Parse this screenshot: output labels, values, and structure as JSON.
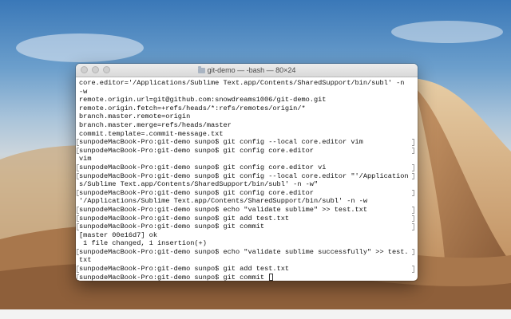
{
  "window": {
    "title": "git-demo — -bash — 80×24"
  },
  "terminal": {
    "lines": [
      {
        "text": "core.editor='/Applications/Sublime Text.app/Contents/SharedSupport/bin/subl' -n",
        "prompt": false
      },
      {
        "text": "-w",
        "prompt": false
      },
      {
        "text": "remote.origin.url=git@github.com:snowdreams1006/git-demo.git",
        "prompt": false
      },
      {
        "text": "remote.origin.fetch=+refs/heads/*:refs/remotes/origin/*",
        "prompt": false
      },
      {
        "text": "branch.master.remote=origin",
        "prompt": false
      },
      {
        "text": "branch.master.merge=refs/heads/master",
        "prompt": false
      },
      {
        "text": "commit.template=.commit-message.txt",
        "prompt": false
      },
      {
        "text": "sunpodeMacBook-Pro:git-demo sunpo$ git config --local core.editor vim",
        "prompt": true
      },
      {
        "text": "sunpodeMacBook-Pro:git-demo sunpo$ git config core.editor",
        "prompt": true
      },
      {
        "text": "vim",
        "prompt": false
      },
      {
        "text": "sunpodeMacBook-Pro:git-demo sunpo$ git config core.editor vi",
        "prompt": true
      },
      {
        "text": "sunpodeMacBook-Pro:git-demo sunpo$ git config --local core.editor \"'/Application",
        "prompt": true
      },
      {
        "text": "s/Sublime Text.app/Contents/SharedSupport/bin/subl' -n -w\"",
        "prompt": false
      },
      {
        "text": "sunpodeMacBook-Pro:git-demo sunpo$ git config core.editor",
        "prompt": true
      },
      {
        "text": "'/Applications/Sublime Text.app/Contents/SharedSupport/bin/subl' -n -w",
        "prompt": false
      },
      {
        "text": "sunpodeMacBook-Pro:git-demo sunpo$ echo \"validate sublime\" >> test.txt",
        "prompt": true
      },
      {
        "text": "sunpodeMacBook-Pro:git-demo sunpo$ git add test.txt",
        "prompt": true
      },
      {
        "text": "sunpodeMacBook-Pro:git-demo sunpo$ git commit",
        "prompt": true
      },
      {
        "text": "[master 00e16d7] ok",
        "prompt": false
      },
      {
        "text": " 1 file changed, 1 insertion(+)",
        "prompt": false
      },
      {
        "text": "sunpodeMacBook-Pro:git-demo sunpo$ echo \"validate sublime successfully\" >> test.",
        "prompt": true
      },
      {
        "text": "txt",
        "prompt": false
      },
      {
        "text": "sunpodeMacBook-Pro:git-demo sunpo$ git add test.txt",
        "prompt": true
      },
      {
        "text": "sunpodeMacBook-Pro:git-demo sunpo$ git commit ",
        "prompt": true,
        "cursor": true
      }
    ]
  }
}
